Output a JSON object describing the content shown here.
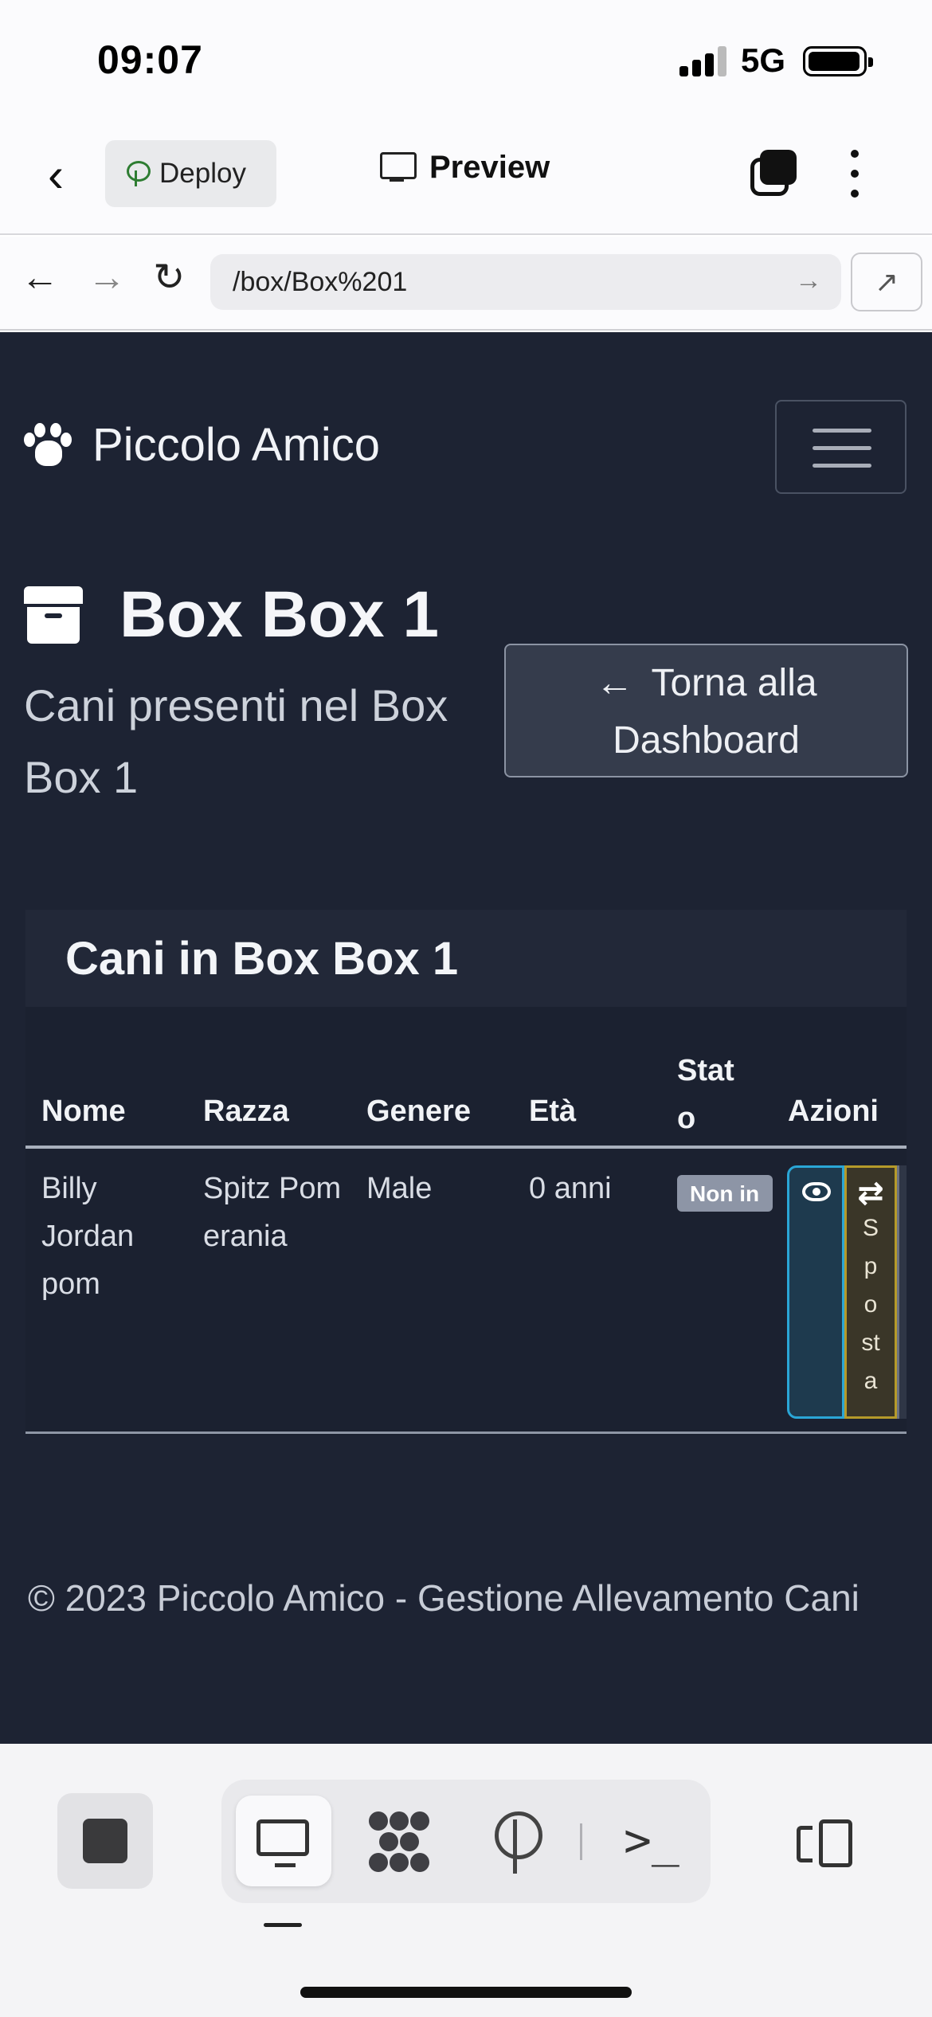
{
  "status_bar": {
    "time": "09:07",
    "network": "5G"
  },
  "app_header": {
    "deploy_label": "Deploy",
    "preview_label": "Preview"
  },
  "browser": {
    "url": "/box/Box%201"
  },
  "navbar": {
    "brand": "Piccolo Amico"
  },
  "page": {
    "title": "Box Box 1",
    "subtitle": "Cani presenti nel Box Box 1",
    "back_button_label": "Torna alla Dashboard"
  },
  "card": {
    "title": "Cani in Box Box 1",
    "columns": [
      "Nome",
      "Razza",
      "Genere",
      "Età",
      "Stato",
      "Azioni"
    ],
    "rows": [
      {
        "nome": "Billy Jordan pom",
        "razza": "Spitz Pomerania",
        "genere": "Male",
        "eta": "0 anni",
        "stato": "Non in",
        "sposta_label": "Sposta"
      }
    ]
  },
  "footer": {
    "text": "© 2023 Piccolo Amico - Gestione Allevamento Cani"
  },
  "colors": {
    "page_bg": "#1d2333",
    "info_accent": "#2aa6d6",
    "warning_accent": "#b59a2a",
    "badge_bg": "#8d95a6"
  }
}
